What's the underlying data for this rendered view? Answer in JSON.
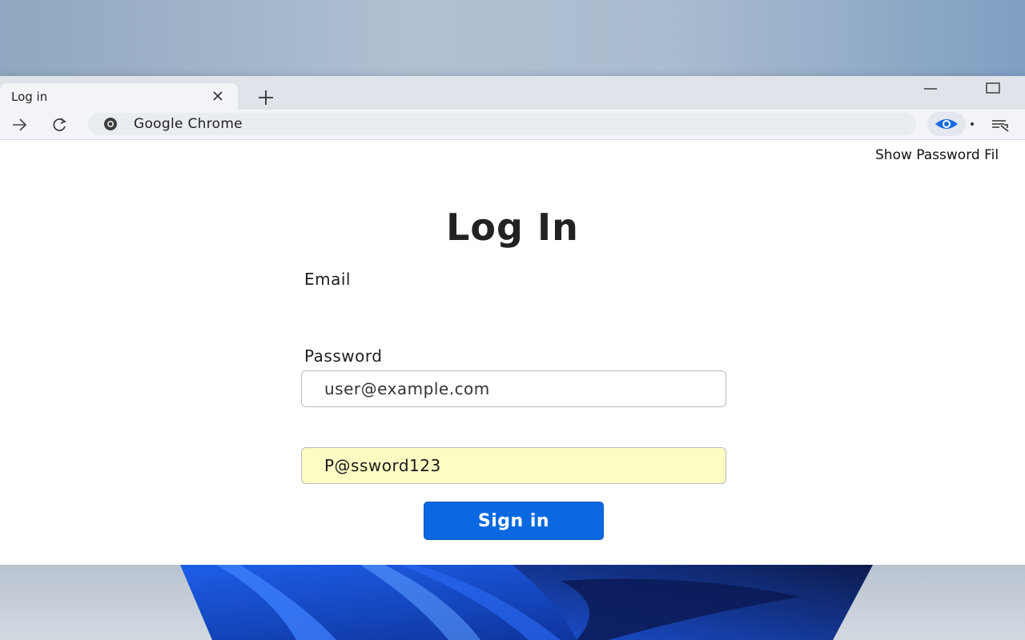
{
  "browser": {
    "tab_title": "Log in",
    "address_text": "Google Chrome"
  },
  "page": {
    "top_link": "Show Password Fil",
    "heading": "Log In",
    "email_label": "Email",
    "email_value": "user@example.com",
    "password_label": "Password",
    "password_value": "P@ssword123",
    "submit_label": "Sign in"
  },
  "colors": {
    "accent": "#0a69e0",
    "password_field_fill": "#fdfcc3",
    "extension_eye": "#1a6be0"
  },
  "icons": {
    "tab_close": "close-icon",
    "new_tab": "plus-icon",
    "minimize": "minimize-icon",
    "maximize": "maximize-icon",
    "forward": "arrow-right-icon",
    "reload": "reload-icon",
    "site_info": "chrome-icon",
    "extension": "eye-icon",
    "extension_menu": "extension-menu-icon"
  }
}
